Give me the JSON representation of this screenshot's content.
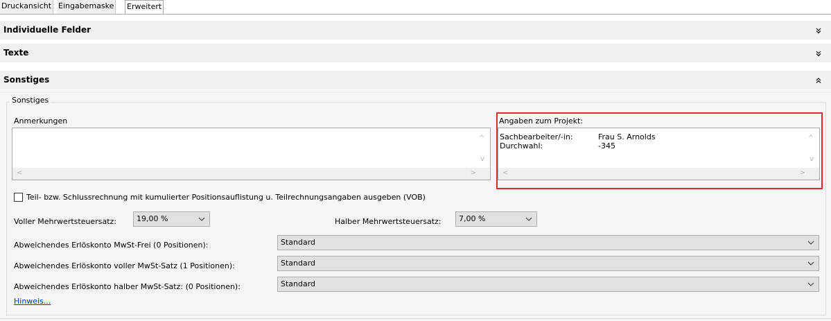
{
  "tabs": [
    {
      "label": "Druckansicht",
      "active": false
    },
    {
      "label": "Eingabemaske",
      "active": false
    },
    {
      "label": "Erweitert",
      "active": true
    }
  ],
  "sections": {
    "individuelle_felder": {
      "title": "Individuelle Felder",
      "expanded": false
    },
    "texte": {
      "title": "Texte",
      "expanded": false
    },
    "sonstiges": {
      "title": "Sonstiges",
      "expanded": true
    }
  },
  "groupbox_title": "Sonstiges",
  "anmerkungen": {
    "label": "Anmerkungen",
    "value": ""
  },
  "projekt": {
    "label": "Angaben zum Projekt:",
    "rows": [
      {
        "key": "Sachbearbeiter/-in:",
        "value": "Frau S. Arnolds"
      },
      {
        "key": "Durchwahl:",
        "value": "-345"
      }
    ]
  },
  "vob_checkbox": {
    "label": "Teil- bzw. Schlussrechnung mit kumulierter Positionsauflistung u. Teilrechnungsangaben ausgeben (VOB)",
    "checked": false
  },
  "mwst": {
    "voll_label": "Voller Mehrwertsteuersatz:",
    "voll_value": "19,00 %",
    "halb_label": "Halber Mehrwertsteuersatz:",
    "halb_value": "7,00 %"
  },
  "erloeskonten": [
    {
      "label": "Abweichendes Erlöskonto MwSt-Frei (0 Positionen):",
      "value": "Standard"
    },
    {
      "label": "Abweichendes Erlöskonto voller MwSt-Satz (1 Positionen):",
      "value": "Standard"
    },
    {
      "label": "Abweichendes Erlöskonto halber MwSt-Satz: (0 Positionen):",
      "value": "Standard"
    }
  ],
  "hinweis_link": "Hinweis...",
  "colors": {
    "highlight": "#d32f2f",
    "link": "#0033cc"
  }
}
